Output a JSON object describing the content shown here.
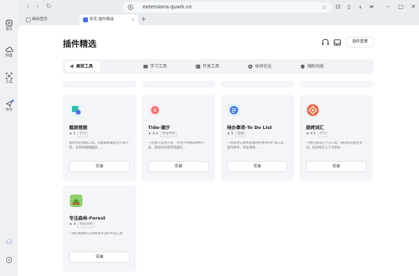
{
  "rail": {
    "items": [
      {
        "label": "首页",
        "icon": "home-icon"
      },
      {
        "label": "网盘",
        "icon": "cloud-icon"
      },
      {
        "label": "工具",
        "icon": "scan-icon"
      },
      {
        "label": "传件",
        "icon": "send-icon"
      }
    ]
  },
  "topbar": {
    "url": "extensions.quark.cn"
  },
  "tabs": [
    {
      "label": "新标签页"
    },
    {
      "label": "夸克-插件精选"
    }
  ],
  "page": {
    "title": "插件精选",
    "manage_label": "插件管理"
  },
  "categories": [
    {
      "label": "高效工具",
      "active": true
    },
    {
      "label": "学习工具",
      "active": false
    },
    {
      "label": "开发工具",
      "active": false
    },
    {
      "label": "体验优化",
      "active": false
    },
    {
      "label": "辅助功能",
      "active": false
    }
  ],
  "extensions": [
    {
      "name": "截屏搜题",
      "rating": "5",
      "tag": "学习",
      "desc": "超好用的搜题工具，海量题库覆盖全学段学科，支持快捷键截屏，…",
      "install": "安装",
      "color": "#2fbfb0"
    },
    {
      "name": "Tide-潮汐",
      "rating": "4.4",
      "tag": "专注计时",
      "desc": "一款基于自然声音、专注计时番茄钟的产品，帮助你在使用电脑的…",
      "install": "安装",
      "color": "#f4606c"
    },
    {
      "name": "待办事项-To Do List",
      "rating": "5",
      "tag": "规划",
      "desc": "一款高效记录和管理待办事项的扩展工具，操作简单，列表清晰，…",
      "install": "安装",
      "color": "#3f7fe0"
    },
    {
      "name": "烧烤词汇",
      "rating": "4.5",
      "tag": "学习",
      "desc": "一款在线词汇学习工具，通过标记陌生单词，结合网页上下文帮你…",
      "install": "安装",
      "color": "#f0643c"
    },
    {
      "name": "专注森林-Forest",
      "rating": "4",
      "tag": "专注计时",
      "desc": "一款以植物的方式养成专注的专注工具",
      "install": "安装",
      "color": "#7ec85a"
    }
  ]
}
